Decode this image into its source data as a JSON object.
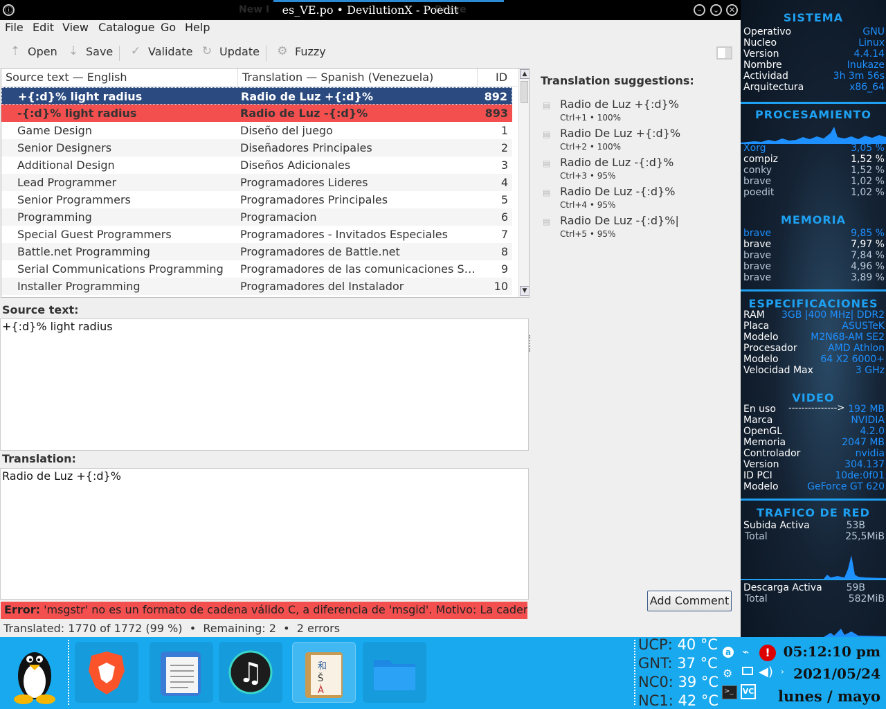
{
  "window": {
    "title": "es_VE.po • DevilutionX - Poedit",
    "ghost_left": "New I",
    "ghost_right": "Brave"
  },
  "menu": [
    "File",
    "Edit",
    "View",
    "Catalogue",
    "Go",
    "Help"
  ],
  "toolbar": {
    "open": "Open",
    "save": "Save",
    "validate": "Validate",
    "update": "Update",
    "fuzzy": "Fuzzy"
  },
  "list": {
    "headers": {
      "source": "Source text — English",
      "translation": "Translation — Spanish (Venezuela)",
      "id": "ID"
    },
    "rows": [
      {
        "source": "+{:d}% light radius",
        "translation": "Radio de Luz +{:d}%",
        "id": "892",
        "state": "selected"
      },
      {
        "source": "-{:d}% light radius",
        "translation": "Radio de Luz -{:d}%",
        "id": "893",
        "state": "error"
      },
      {
        "source": "Game Design",
        "translation": "Diseño del juego",
        "id": "1",
        "state": ""
      },
      {
        "source": "Senior Designers",
        "translation": "Diseñadores Principales",
        "id": "2",
        "state": ""
      },
      {
        "source": "Additional Design",
        "translation": "Diseños Adicionales",
        "id": "3",
        "state": ""
      },
      {
        "source": "Lead Programmer",
        "translation": "Programadores Lideres",
        "id": "4",
        "state": ""
      },
      {
        "source": "Senior Programmers",
        "translation": "Programadores Principales",
        "id": "5",
        "state": ""
      },
      {
        "source": "Programming",
        "translation": "Programacion",
        "id": "6",
        "state": ""
      },
      {
        "source": "Special Guest Programmers",
        "translation": "Programadores - Invitados Especiales",
        "id": "7",
        "state": ""
      },
      {
        "source": "Battle.net Programming",
        "translation": "Programadores de Battle.net",
        "id": "8",
        "state": ""
      },
      {
        "source": "Serial Communications Programming",
        "translation": "Programadores de las comunicaciones Ser…",
        "id": "9",
        "state": ""
      },
      {
        "source": "Installer Programming",
        "translation": "Programadores del Instalador",
        "id": "10",
        "state": ""
      }
    ]
  },
  "editor": {
    "source_label": "Source text:",
    "source_text": "+{:d}% light radius",
    "translation_label": "Translation:",
    "translation_text": "Radio de Luz +{:d}%"
  },
  "error": {
    "label": "Error:",
    "message": " 'msgstr' no es un formato de cadena válido C, a diferencia de 'msgid'. Motivo: La cadena"
  },
  "status": "Translated: 1770 of 1772 (99 %)  •  Remaining: 2  •  2 errors",
  "suggestions": {
    "title": "Translation suggestions:",
    "items": [
      {
        "text": "Radio de Luz +{:d}%",
        "shortcut": "Ctrl+1 • 100%"
      },
      {
        "text": "Radio De Luz +{:d}%",
        "shortcut": "Ctrl+2 • 100%"
      },
      {
        "text": "Radio de Luz -{:d}%",
        "shortcut": "Ctrl+3 • 95%"
      },
      {
        "text": "Radio De Luz -{:d}%",
        "shortcut": "Ctrl+4 • 95%"
      },
      {
        "text": "Radio De Luz -{:d}%|",
        "shortcut": "Ctrl+5 • 95%"
      }
    ],
    "add_comment": "Add Comment"
  },
  "conky": {
    "sistema": {
      "title": "SISTEMA",
      "rows": [
        [
          "Operativo",
          "GNU"
        ],
        [
          "Nucleo",
          "Linux"
        ],
        [
          "Version",
          "4.4.14"
        ],
        [
          "Nombre",
          "Inukaze"
        ],
        [
          "Actividad",
          "3h 3m 56s"
        ],
        [
          "Arquitectura",
          "x86_64"
        ]
      ]
    },
    "procesamiento": {
      "title": "PROCESAMIENTO",
      "rows": [
        [
          "Xorg",
          "3,05 %"
        ],
        [
          "compiz",
          "1,52 %"
        ],
        [
          "conky",
          "1,52 %"
        ],
        [
          "brave",
          "1,02 %"
        ],
        [
          "poedit",
          "1,02 %"
        ]
      ]
    },
    "memoria": {
      "title": "MEMORIA",
      "rows": [
        [
          "brave",
          "9,85 %"
        ],
        [
          "brave",
          "7,97 %"
        ],
        [
          "brave",
          "7,84 %"
        ],
        [
          "brave",
          "4,96 %"
        ],
        [
          "brave",
          "3,89 %"
        ]
      ]
    },
    "especificaciones": {
      "title": "ESPECIFICACIONES",
      "rows": [
        [
          "RAM",
          "3GB |400 MHz| DDR2"
        ],
        [
          "Placa",
          "ASUSTeK"
        ],
        [
          "Modelo",
          "M2N68-AM SE2"
        ],
        [
          "Procesador",
          "AMD Athlon"
        ],
        [
          "Modelo",
          "64 X2 6000+"
        ],
        [
          "Velocidad Max",
          "3 GHz"
        ]
      ]
    },
    "video": {
      "title": "VIDEO",
      "rows": [
        [
          "En uso",
          "192 MB"
        ],
        [
          "Marca",
          "NVIDIA"
        ],
        [
          "OpenGL",
          "4.2.0"
        ],
        [
          "Memoria",
          "2047 MB"
        ],
        [
          "Controlador",
          "nvidia"
        ],
        [
          "Version",
          "304.137"
        ],
        [
          "ID PCI",
          "10de:0f01"
        ],
        [
          "Modelo",
          "GeForce GT 620"
        ]
      ],
      "arrow": "--------------->"
    },
    "red": {
      "title": "TRAFICO DE RED",
      "upload_label": "Subida Activa",
      "upload": "53B",
      "upload_total_label": "Total",
      "upload_total": "25,5MiB",
      "download_label": "Descarga Activa",
      "download": "59B",
      "download_total_label": "Total",
      "download_total": "582MiB"
    }
  },
  "taskbar": {
    "temps": [
      {
        "label": "UCP:",
        "value": "40 °C"
      },
      {
        "label": "GNT:",
        "value": "37 °C"
      },
      {
        "label": "NC0:",
        "value": "39 °C"
      },
      {
        "label": "NC1:",
        "value": "42 °C"
      }
    ],
    "time": "05:12:10 pm",
    "date": "2021/05/24",
    "day": "lunes / mayo"
  }
}
